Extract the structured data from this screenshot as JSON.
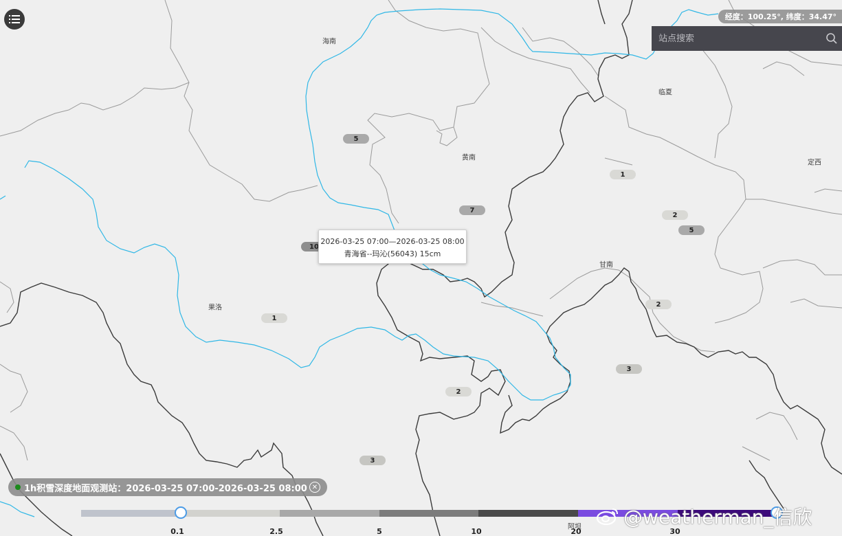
{
  "menu": {
    "icon": "menu-icon"
  },
  "coord_readout": "经度：100.25°, 纬度：34.47°",
  "search": {
    "placeholder": "站点搜索",
    "icon": "search-icon"
  },
  "places": {
    "hainan": "海南",
    "huangnan": "黄南",
    "linxia": "临夏",
    "dingxi": "定西",
    "gannan": "甘南",
    "guoluo": "果洛",
    "aba": "阿坝"
  },
  "stations": {
    "s1": "5",
    "s2": "7",
    "s3": "1",
    "s4": "2",
    "s5": "5",
    "s6": "10",
    "s7": "1",
    "s8": "2",
    "s9": "3",
    "s10": "2",
    "s11": "3"
  },
  "tooltip": {
    "time": "2026-03-25 07:00—2026-03-25 08:00",
    "station": "青海省--玛沁(56043) 15cm"
  },
  "legend": {
    "title": "1h积雪深度地面观测站：2026-03-25 07:00-2026-03-25 08:00",
    "close_icon": "close-icon",
    "ticks": [
      "0.1",
      "2.5",
      "5",
      "10",
      "20",
      "30"
    ],
    "colors": [
      "#bfc3cc",
      "#d2d2ce",
      "#a8a8a8",
      "#7c7c7c",
      "#4a4a4a",
      "#7a4be0",
      "#3c0a7a"
    ]
  },
  "watermark": "@weatherman_信欣"
}
